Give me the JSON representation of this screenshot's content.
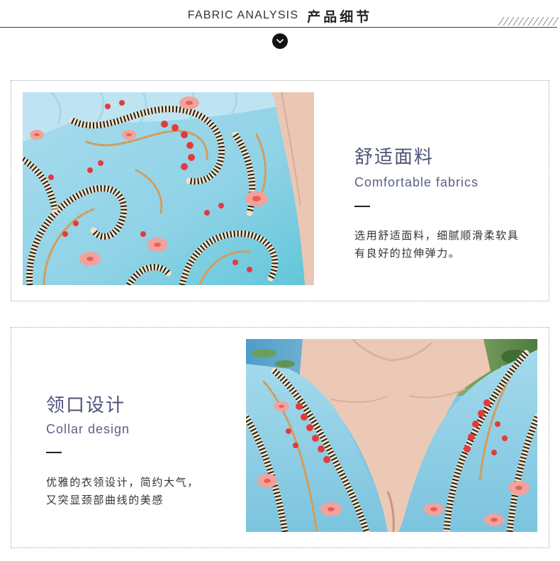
{
  "header": {
    "title_en": "FABRIC ANALYSIS",
    "title_cn": "产品细节",
    "scroll_icon": "chevron-down-icon"
  },
  "sections": [
    {
      "title_cn": "舒适面料",
      "title_en": "Comfortable fabrics",
      "desc": [
        "选用舒适面料，细腻顺滑柔软具",
        "有良好的拉伸弹力。"
      ]
    },
    {
      "title_cn": "领口设计",
      "title_en": "Collar design",
      "desc": [
        "优雅的衣领设计，简约大气，",
        "又突显颈部曲线的美感"
      ]
    }
  ],
  "colors": {
    "title": "#4d5378",
    "title_en": "#5a6186",
    "text": "#333333",
    "border": "#a8a8a8",
    "fabric": "#8fd2e6"
  }
}
